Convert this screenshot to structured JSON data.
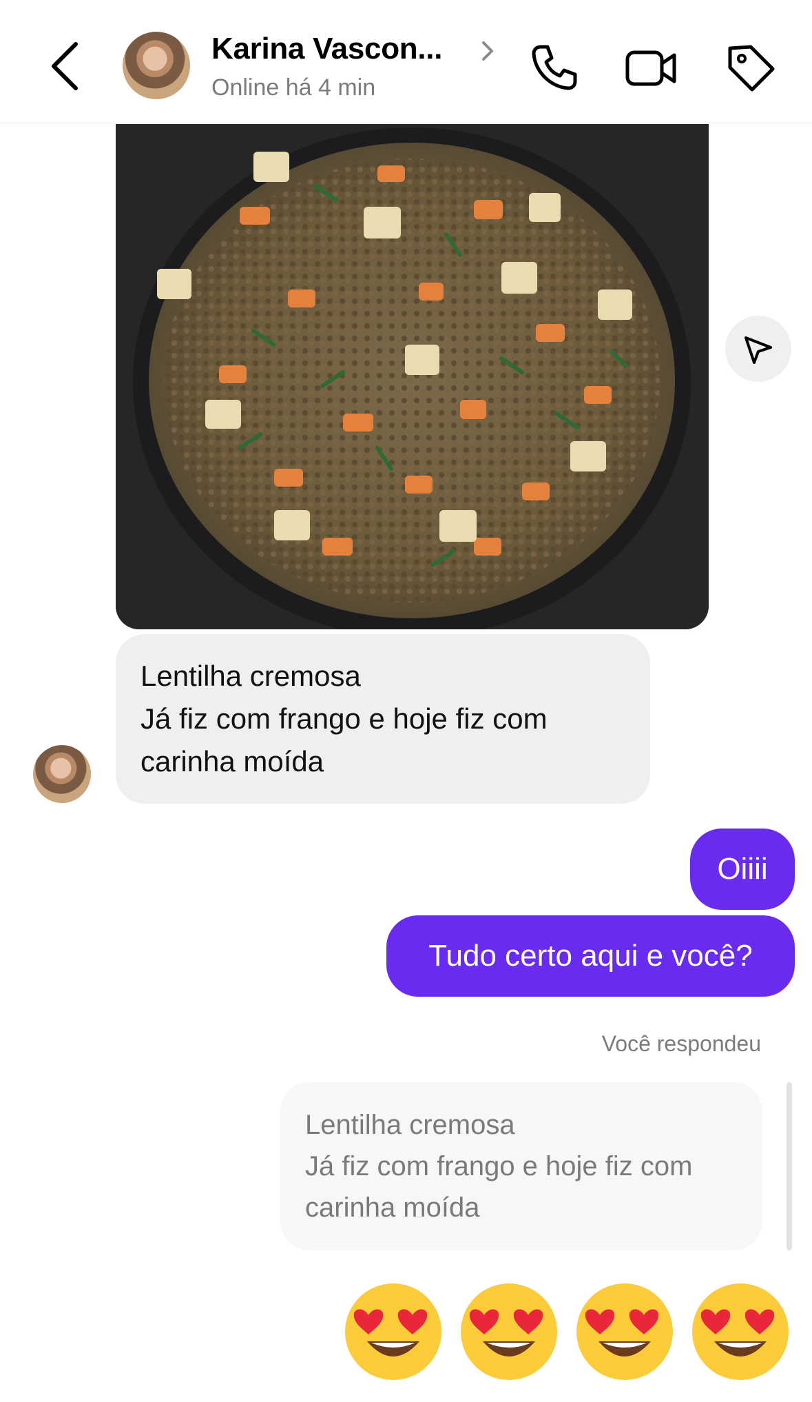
{
  "header": {
    "contact_name": "Karina Vascon...",
    "status": "Online há 4 min"
  },
  "messages": {
    "received_text_line1": "Lentilha cremosa",
    "received_text_line2": "Já fiz com frango e hoje fiz com",
    "received_text_line3": "carinha moída",
    "sent_1": "Oiiii",
    "sent_2": "Tudo certo aqui e você?",
    "reply_caption": "Você respondeu",
    "reply_line1": "Lentilha cremosa",
    "reply_line2": "Já fiz com frango e hoje fiz com",
    "reply_line3": "carinha moída",
    "reactions": [
      "😍",
      "😍",
      "😍",
      "😍"
    ]
  },
  "colors": {
    "sent_bubble": "#6a2bf0",
    "received_bubble": "#efeff1"
  },
  "icons": [
    "back-icon",
    "chevron-right-icon",
    "phone-icon",
    "video-icon",
    "tag-icon",
    "send-icon"
  ]
}
